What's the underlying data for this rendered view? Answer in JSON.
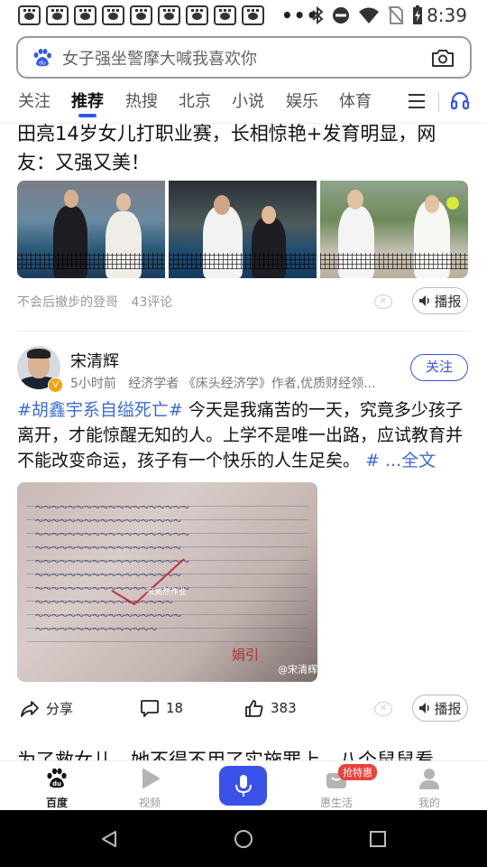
{
  "status_bar": {
    "time": "8:39",
    "dots": "•••"
  },
  "search": {
    "placeholder": "女子强坐警摩大喊我喜欢你"
  },
  "tabs": [
    {
      "label": "关注"
    },
    {
      "label": "推荐"
    },
    {
      "label": "热搜"
    },
    {
      "label": "北京"
    },
    {
      "label": "小说"
    },
    {
      "label": "娱乐"
    },
    {
      "label": "体育"
    }
  ],
  "active_tab": "推荐",
  "feed": {
    "item1": {
      "title": "田亮14岁女儿打职业赛，长相惊艳+发育明显，网友：又强又美！",
      "source": "不会后撤步的登哥",
      "comments": "43评论",
      "broadcast": "播报"
    },
    "item2": {
      "author": "宋清辉",
      "time": "5小时前",
      "intro": "经济学者 《床头经济学》作者,优质财经领...",
      "follow": "关注",
      "hashtag": "#胡鑫宇系自缢死亡#",
      "text": " 今天是我痛苦的一天，究竟多少孩子离开，才能惊醒无知的人。上学不是唯一出路，应试教育并不能改变命运，孩子有一个快乐的人生足矣。",
      "more": "# ...全文",
      "image_watermark": "宋昊然作业",
      "image_credit": "@宋清辉",
      "signature": "娟引",
      "share": "分享",
      "comment_count": "18",
      "like_count": "383",
      "broadcast": "播报"
    },
    "item3": {
      "title": "为了救女儿，她不得不用了实施罪上，八个鼠鼠看"
    }
  },
  "bottom_nav": [
    {
      "label": "百度"
    },
    {
      "label": "视频"
    },
    {
      "label": "惠生活"
    },
    {
      "label": "我的"
    }
  ],
  "promo_badge": "抢特惠",
  "colors": {
    "accent": "#3456e6",
    "promo": "#e8423a"
  }
}
